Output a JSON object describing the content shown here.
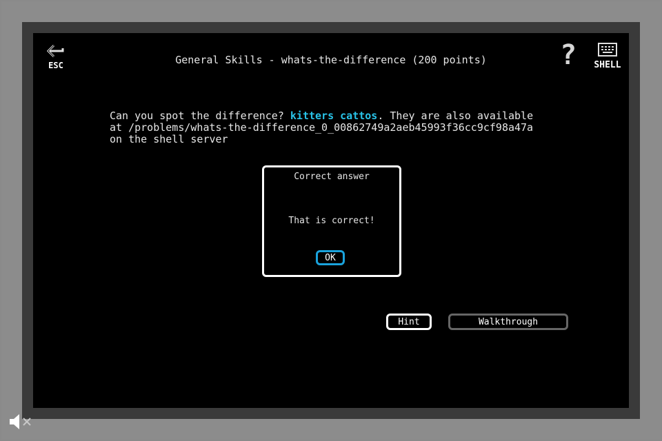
{
  "header": {
    "esc_label": "ESC",
    "title": "General Skills - whats-the-difference (200 points)",
    "help_label": "?",
    "shell_label": "SHELL"
  },
  "problem": {
    "text_before_link": "Can you spot the difference? ",
    "link_text": "kitters cattos",
    "text_after_link": ". They are also available at /problems/whats-the-difference_0_00862749a2aeb45993f36cc9cf98a47a on the shell server"
  },
  "modal": {
    "title": "Correct answer",
    "message": "That is correct!",
    "ok_label": "OK"
  },
  "buttons": {
    "hint_label": "Hint",
    "walkthrough_label": "Walkthrough"
  },
  "icons": {
    "back": "back-arrow-icon",
    "help": "question-mark-icon",
    "shell": "keyboard-icon",
    "sound": "speaker-muted-icon"
  },
  "colors": {
    "link": "#29c3e8",
    "ok_border": "#1aa3dd",
    "screen_bg": "#000000"
  }
}
